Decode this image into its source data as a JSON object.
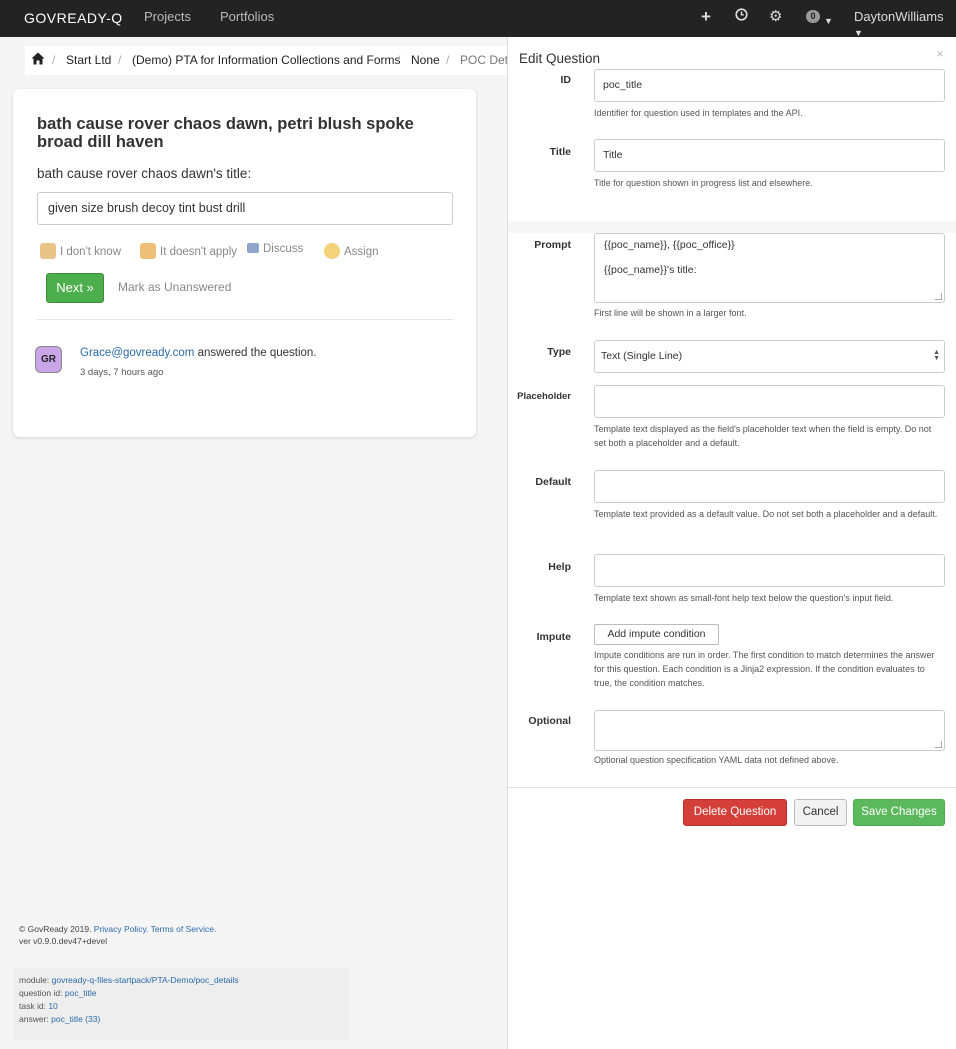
{
  "navbar": {
    "brand": "GOVREADY-Q",
    "links": [
      "Projects",
      "Portfolios"
    ],
    "icons": [
      "plus-icon",
      "clock-icon",
      "gear-icon"
    ],
    "notification_count": "0",
    "user": "DaytonWilliams"
  },
  "breadcrumb": {
    "items": [
      "Start Ltd",
      "(Demo) PTA for Information Collections and Forms",
      "None"
    ],
    "current": "POC Details"
  },
  "question": {
    "title": "bath cause rover chaos dawn, petri blush spoke broad dill haven",
    "prompt": "bath cause rover chaos dawn's title:",
    "answer_value": "given size brush decoy tint bust drill",
    "actions": {
      "dont_know": "I don't know",
      "doesnt_apply": "It doesn't apply",
      "discuss": "Discuss",
      "assign": "Assign"
    },
    "next_label": "Next »",
    "mark_unanswered": "Mark as Unanswered",
    "activity": {
      "avatar": "GR",
      "user": "Grace@govready.com",
      "text": "answered the question.",
      "time": "3 days, 7 hours ago"
    }
  },
  "footer": {
    "copyright": "© GovReady 2019.",
    "privacy": "Privacy Policy.",
    "terms": "Terms of Service.",
    "version": "ver v0.9.0.dev47+devel"
  },
  "debug": {
    "module_label": "module:",
    "module_value": "govready-q-files-startpack/PTA-Demo/poc_details",
    "qid_label": "question id:",
    "qid_value": "poc_title",
    "task_label": "task id:",
    "task_value": "10",
    "answer_label": "answer:",
    "answer_value": "poc_title (33)"
  },
  "modal": {
    "title": "Edit Question",
    "close": "×",
    "fields": {
      "id": {
        "label": "ID",
        "value": "poc_title",
        "help": "Identifier for question used in templates and the API."
      },
      "title": {
        "label": "Title",
        "value": "Title",
        "help": "Title for question shown in progress list and elsewhere."
      },
      "prompt": {
        "label": "Prompt",
        "line1": "{{poc_name}}, {{poc_office}}",
        "line2": "{{poc_name}}'s title:",
        "help": "First line will be shown in a larger font."
      },
      "type": {
        "label": "Type",
        "value": "Text (Single Line)"
      },
      "placeholder": {
        "label": "Placeholder",
        "value": "",
        "help": "Template text displayed as the field's placeholder text when the field is empty. Do not set both a placeholder and a default."
      },
      "default": {
        "label": "Default",
        "value": "",
        "help": "Template text provided as a default value. Do not set both a placeholder and a default."
      },
      "help": {
        "label": "Help",
        "value": "",
        "help": "Template text shown as small-font help text below the question's input field."
      },
      "impute": {
        "label": "Impute",
        "button": "Add impute condition",
        "help": "Impute conditions are run in order. The first condition to match determines the answer for this question. Each condition is a Jinja2 expression. If the condition evaluates to true, the condition matches."
      },
      "optional": {
        "label": "Optional",
        "value": "",
        "help": "Optional question specification YAML data not defined above."
      }
    },
    "buttons": {
      "delete": "Delete Question",
      "cancel": "Cancel",
      "save": "Save Changes"
    }
  }
}
